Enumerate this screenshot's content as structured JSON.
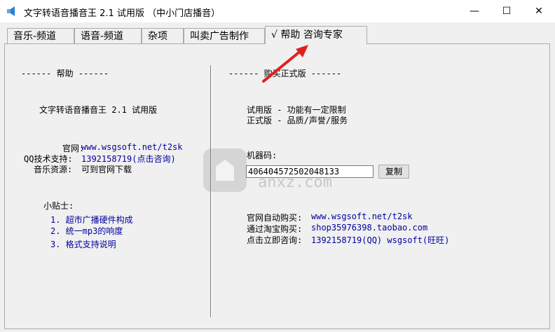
{
  "window": {
    "title": "文字转语音播音王 2.1 试用版 （中小门店播音）",
    "minimize": "—",
    "maximize": "☐",
    "close": "✕"
  },
  "tabs": [
    {
      "label": "音乐-频道"
    },
    {
      "label": "语音-频道"
    },
    {
      "label": "杂项"
    },
    {
      "label": "叫卖广告制作"
    },
    {
      "label": "√ 帮助 咨询专家"
    }
  ],
  "help": {
    "header": "------ 帮助 ------",
    "product": "文字转语音播音王 2.1 试用版",
    "website_label": "官网:",
    "website_value": "www.wsgsoft.net/t2sk",
    "qq_label": "QQ技术支持:",
    "qq_value": "1392158719(点击咨询)",
    "music_label": "音乐资源:",
    "music_value": "可到官网下载",
    "tips_header": "小贴士:",
    "tips": [
      "1.  超市广播硬件构成",
      "2.  统一mp3的响度",
      "3.  格式支持说明"
    ]
  },
  "buy": {
    "header": "------ 购买正式版 ------",
    "trial": "试用版 - 功能有一定限制",
    "full": "正式版 - 品质/声誉/服务",
    "machine_label": "机器码:",
    "machine_code": "40640457250204813З",
    "copy_button": "复制",
    "auto_buy_label": "官网自动购买:",
    "auto_buy_value": "www.wsgsoft.net/t2sk",
    "taobao_label": "通过淘宝购买:",
    "taobao_value": "shop35976398.taobao.com",
    "consult_label": "点击立即咨询:",
    "consult_value": "1392158719(QQ)   wsgsoft(旺旺)"
  },
  "watermark": {
    "text": "anxz.com"
  },
  "colors": {
    "link_blue": "#0000a0",
    "arrow_red": "#e02020"
  }
}
